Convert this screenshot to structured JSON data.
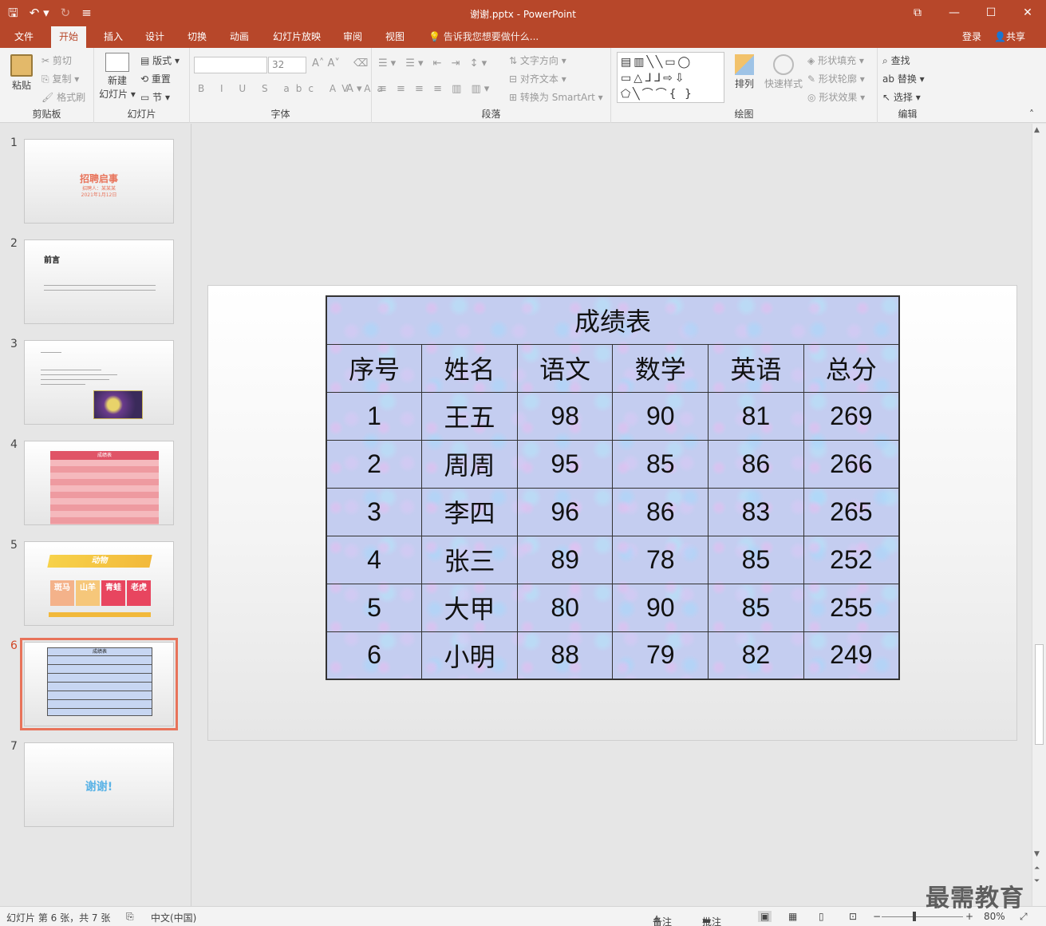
{
  "window": {
    "title": "谢谢.pptx - PowerPoint",
    "qat_icons": [
      "save-icon",
      "undo-icon",
      "redo-icon",
      "customize-icon"
    ]
  },
  "tabs": [
    {
      "label": "文件",
      "active": false
    },
    {
      "label": "开始",
      "active": true
    },
    {
      "label": "插入",
      "active": false
    },
    {
      "label": "设计",
      "active": false
    },
    {
      "label": "切换",
      "active": false
    },
    {
      "label": "动画",
      "active": false
    },
    {
      "label": "幻灯片放映",
      "active": false
    },
    {
      "label": "审阅",
      "active": false
    },
    {
      "label": "视图",
      "active": false
    }
  ],
  "tellme": "告诉我您想要做什么...",
  "account": {
    "login": "登录",
    "share": "共享"
  },
  "ribbon": {
    "clipboard": {
      "label": "剪贴板",
      "paste": "粘贴",
      "cut": "剪切",
      "copy": "复制",
      "format_painter": "格式刷"
    },
    "slides": {
      "label": "幻灯片",
      "new_slide_1": "新建",
      "new_slide_2": "幻灯片",
      "layout": "版式",
      "reset": "重置",
      "section": "节"
    },
    "font": {
      "label": "字体",
      "font_name": "",
      "font_size": "32"
    },
    "paragraph": {
      "label": "段落",
      "text_direction": "文字方向",
      "align_text": "对齐文本",
      "smartart": "转换为 SmartArt"
    },
    "drawing": {
      "label": "绘图",
      "arrange": "排列",
      "quick_styles": "快速样式",
      "shape_fill": "形状填充",
      "shape_outline": "形状轮廓",
      "shape_effects": "形状效果"
    },
    "editing": {
      "label": "编辑",
      "find": "查找",
      "replace": "替换",
      "select": "选择"
    }
  },
  "thumbnails": {
    "selected": 6,
    "s1": {
      "num": "1",
      "title": "招聘启事",
      "sub1": "招聘人：某某某",
      "sub2": "2021年1月12日"
    },
    "s2": {
      "num": "2",
      "title": "前言"
    },
    "s3": {
      "num": "3"
    },
    "s4": {
      "num": "4",
      "title": "成绩表"
    },
    "s5": {
      "num": "5",
      "title": "动物",
      "cards": [
        "斑马",
        "山羊",
        "青蛙",
        "老虎"
      ]
    },
    "s6": {
      "num": "6",
      "title": "成绩表"
    },
    "s7": {
      "num": "7",
      "title": "谢谢!"
    }
  },
  "table": {
    "caption": "成绩表",
    "headers": [
      "序号",
      "姓名",
      "语文",
      "数学",
      "英语",
      "总分"
    ],
    "rows": [
      [
        "1",
        "王五",
        "98",
        "90",
        "81",
        "269"
      ],
      [
        "2",
        "周周",
        "95",
        "85",
        "86",
        "266"
      ],
      [
        "3",
        "李四",
        "96",
        "86",
        "83",
        "265"
      ],
      [
        "4",
        "张三",
        "89",
        "78",
        "85",
        "252"
      ],
      [
        "5",
        "大甲",
        "80",
        "90",
        "85",
        "255"
      ],
      [
        "6",
        "小明",
        "88",
        "79",
        "82",
        "249"
      ]
    ]
  },
  "status": {
    "slide_info": "幻灯片 第 6 张，共 7 张",
    "language": "中文(中国)",
    "notes": "备注",
    "comments": "批注",
    "zoom": "80%"
  },
  "watermark": "最需教育",
  "colors": {
    "accent": "#b7472a",
    "selection": "#e8735a"
  }
}
